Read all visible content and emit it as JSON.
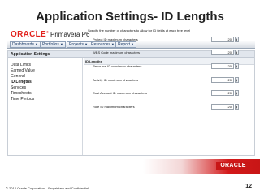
{
  "slide": {
    "title": "Application Settings- ID Lengths",
    "footer": "© 2012 Oracle Corporation – Proprietary and Confidential",
    "page_number": "12",
    "bottom_logo": "ORACLE"
  },
  "app": {
    "logo": "ORACLE",
    "product": "Primavera P6"
  },
  "nav": {
    "items": [
      {
        "label": "Dashboards"
      },
      {
        "label": "Portfolios"
      },
      {
        "label": "Projects"
      },
      {
        "label": "Resources"
      },
      {
        "label": "Report"
      }
    ]
  },
  "settings": {
    "header": "Application Settings",
    "menu": [
      {
        "label": "Data Limits"
      },
      {
        "label": "Earned Value"
      },
      {
        "label": "General"
      },
      {
        "label": "ID Lengths",
        "active": true
      },
      {
        "label": "Services"
      },
      {
        "label": "Timesheets"
      },
      {
        "label": "Time Periods"
      }
    ]
  },
  "detail": {
    "header": "ID Lengths",
    "instructions": "Specify the number of characters to allow for ID fields at each tree level",
    "fields": [
      {
        "label": "Project ID maximum characters",
        "value": "20"
      },
      {
        "label": "WBS Code maximum characters",
        "value": "20"
      },
      {
        "label": "Resource ID maximum characters",
        "value": "20"
      },
      {
        "label": "Activity ID maximum characters",
        "value": "20"
      },
      {
        "label": "Cost Account ID maximum characters",
        "value": "20"
      },
      {
        "label": "Role ID maximum characters",
        "value": "20"
      }
    ]
  },
  "colors": {
    "oracle_red": "#c81616",
    "nav_text": "#1a3a66"
  }
}
